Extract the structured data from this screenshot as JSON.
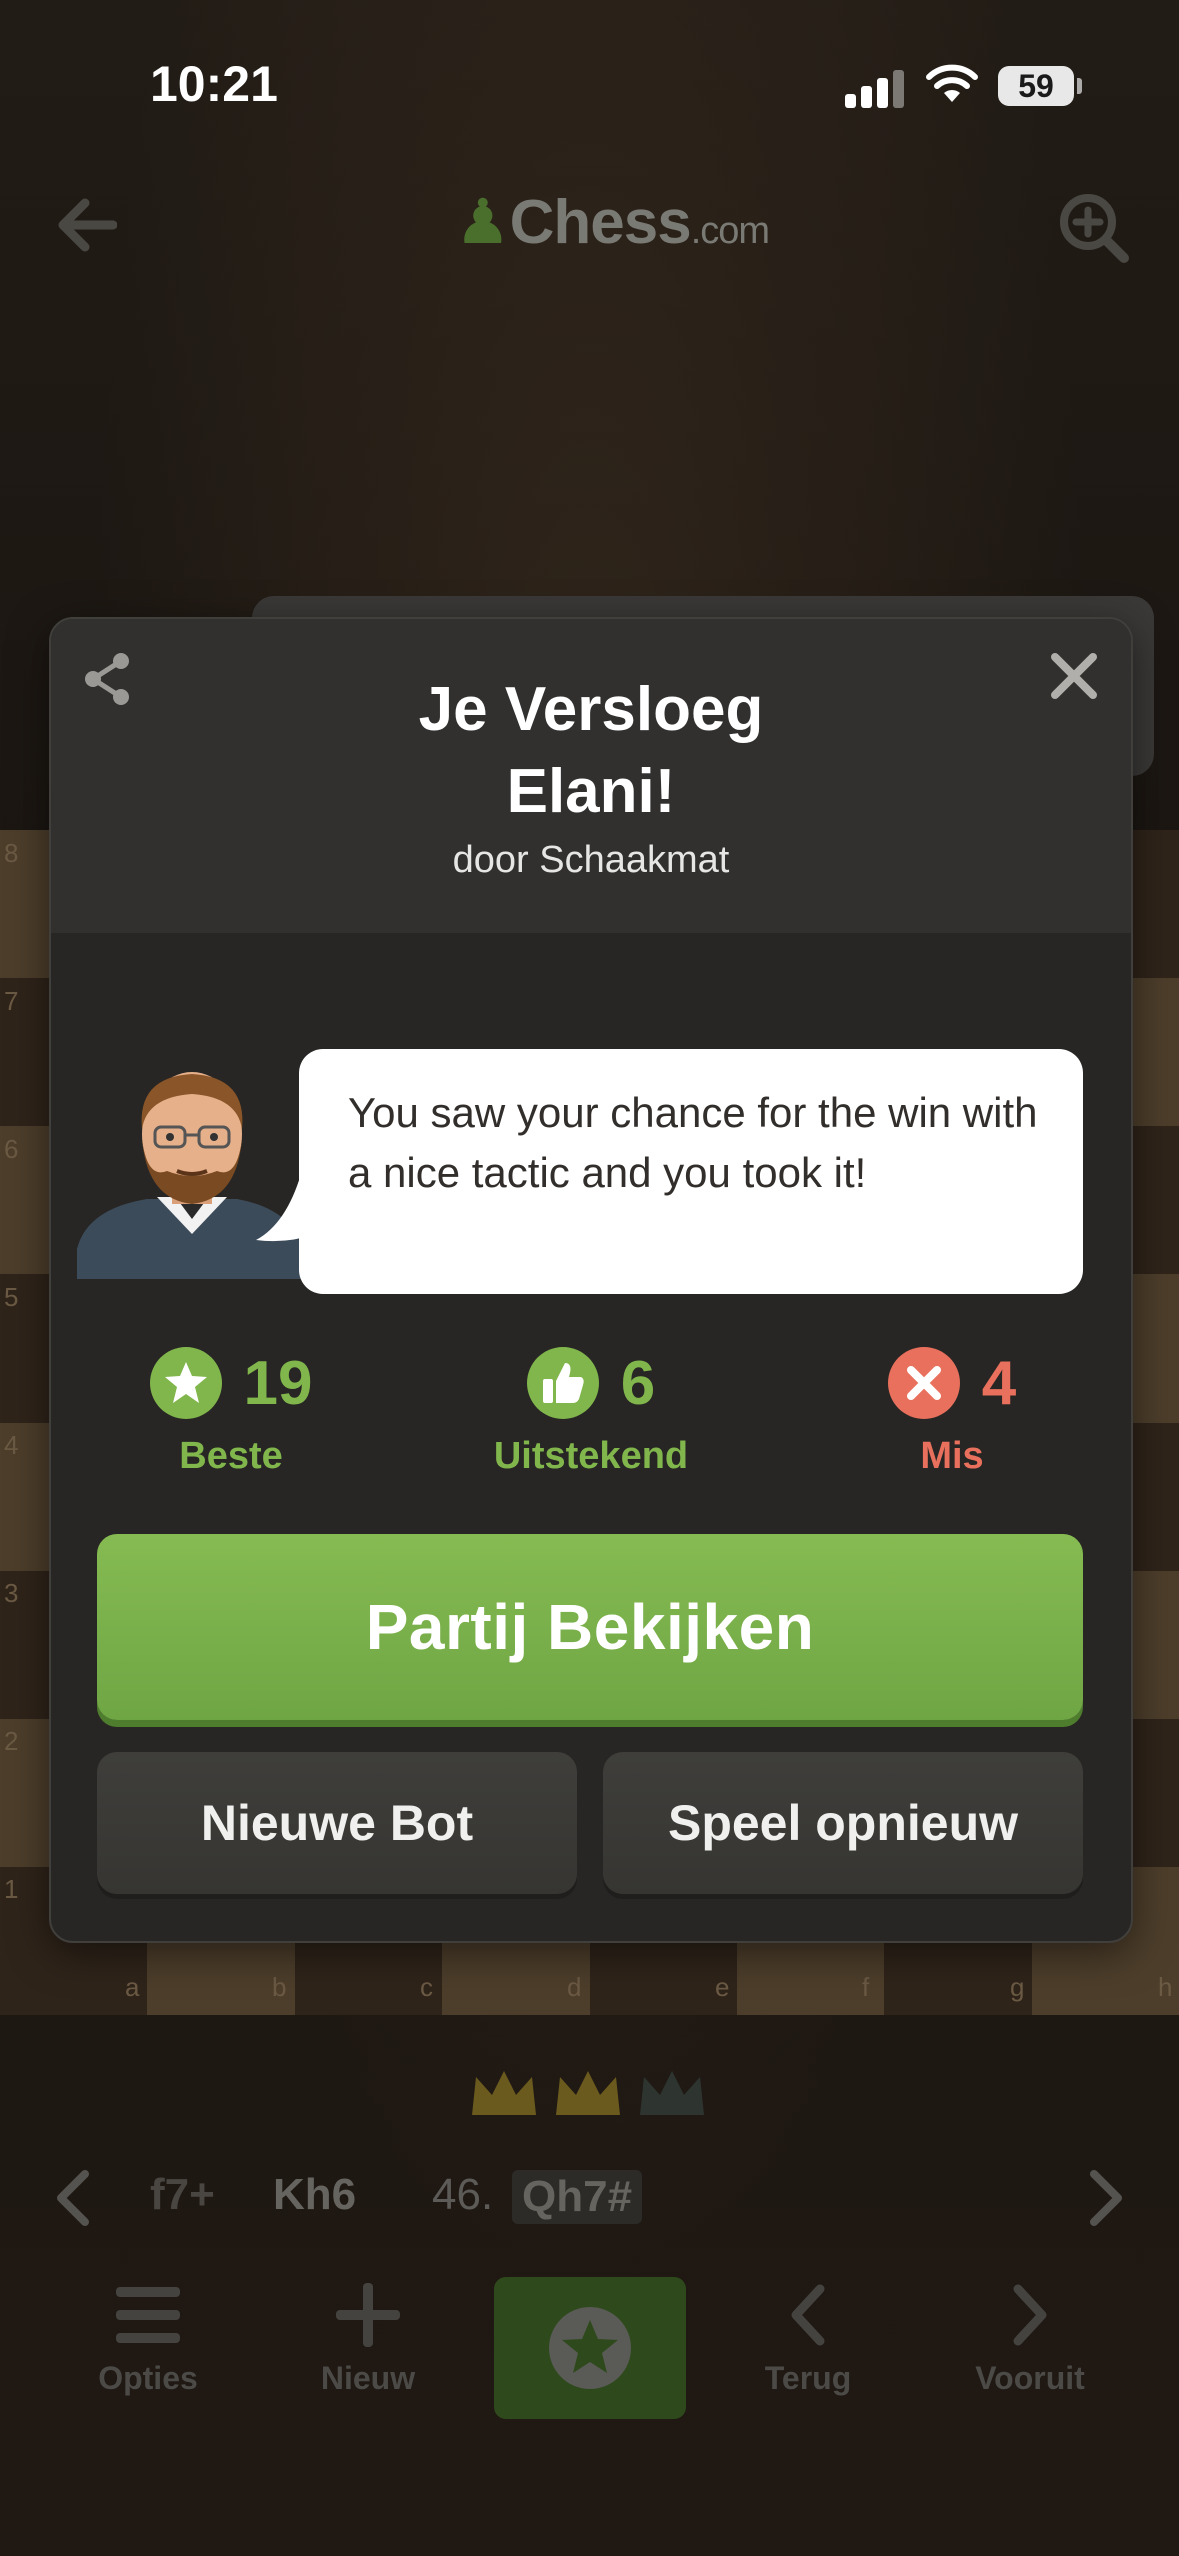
{
  "status_bar": {
    "time": "10:21",
    "battery": "59"
  },
  "app": {
    "logo_text": "Chess",
    "logo_suffix": ".com",
    "ranks": [
      "8",
      "7",
      "6",
      "5",
      "4",
      "3",
      "2",
      "1"
    ],
    "files": [
      "a",
      "b",
      "c",
      "d",
      "e",
      "f",
      "g",
      "h"
    ],
    "moves": {
      "prev_partial": "f7+",
      "prev_black": "Kh6",
      "move_number": "46.",
      "current": "Qh7#"
    },
    "bottom_nav": [
      {
        "label": "Opties",
        "icon": "menu-icon"
      },
      {
        "label": "Nieuw",
        "icon": "plus-icon"
      },
      {
        "label": "Terug",
        "icon": "chevron-left-icon"
      },
      {
        "label": "Vooruit",
        "icon": "chevron-right-icon"
      }
    ]
  },
  "modal": {
    "title_line1": "Je Versloeg",
    "title_line2": "Elani!",
    "subtitle": "door Schaakmat",
    "coach_message": "You saw your chance for the win with a nice tactic and you took it!",
    "stats": [
      {
        "value": "19",
        "label": "Beste",
        "icon": "star-icon",
        "color": "#81b64c"
      },
      {
        "value": "6",
        "label": "Uitstekend",
        "icon": "thumbs-up-icon",
        "color": "#81b64c"
      },
      {
        "value": "4",
        "label": "Mis",
        "icon": "x-circle-icon",
        "color": "#e8705c"
      }
    ],
    "primary_button": "Partij Bekijken",
    "new_bot_button": "Nieuwe Bot",
    "replay_button": "Speel opnieuw"
  },
  "colors": {
    "accent_green": "#81b64c",
    "miss_red": "#e8705c",
    "modal_bg": "#272624"
  }
}
